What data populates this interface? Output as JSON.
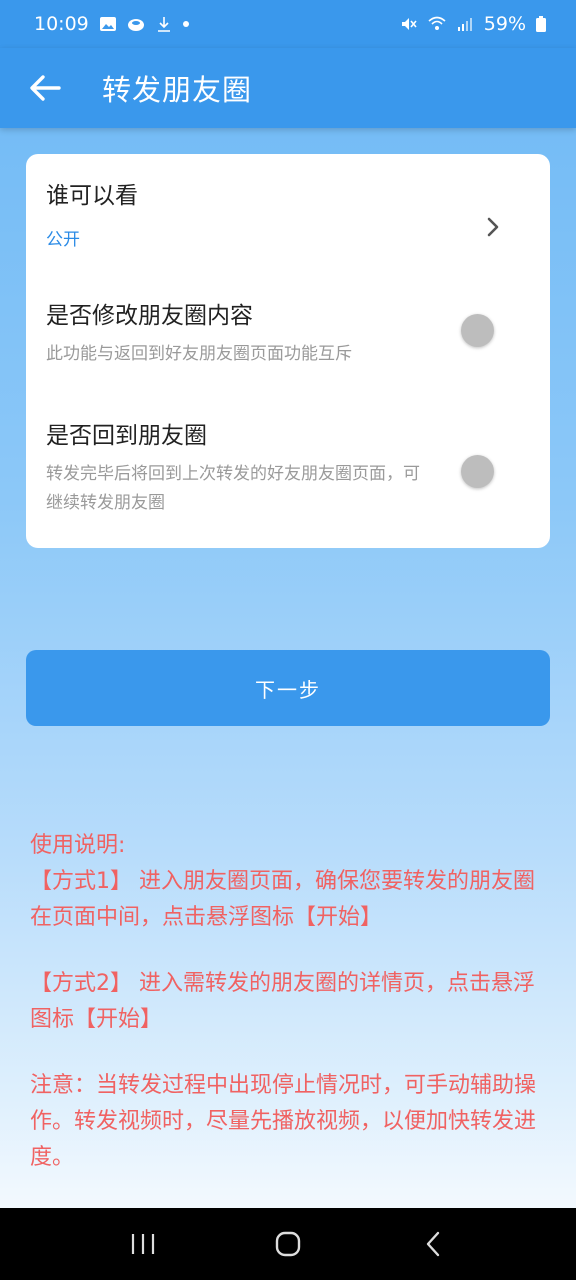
{
  "status_bar": {
    "time": "10:09",
    "battery": "59%"
  },
  "app_bar": {
    "title": "转发朋友圈",
    "back_icon": "arrow-left-icon"
  },
  "settings": {
    "visibility": {
      "title": "谁可以看",
      "value": "公开"
    },
    "modify_content": {
      "title": "是否修改朋友圈内容",
      "description": "此功能与返回到好友朋友圈页面功能互斥",
      "enabled": false
    },
    "return_moments": {
      "title": "是否回到朋友圈",
      "description": "转发完毕后将回到上次转发的好友朋友圈页面，可继续转发朋友圈",
      "enabled": false
    }
  },
  "next_button": {
    "label": "下一步"
  },
  "instructions": {
    "heading": "使用说明:",
    "method1": " 【方式1】 进入朋友圈页面，确保您要转发的朋友圈在页面中间，点击悬浮图标【开始】",
    "method2": " 【方式2】 进入需转发的朋友圈的详情页，点击悬浮图标【开始】",
    "note": " 注意：当转发过程中出现停止情况时，可手动辅助操作。转发视频时，尽量先播放视频，以便加快转发进度。"
  },
  "colors": {
    "primary": "#3a98ec",
    "instruction_text": "#f06262",
    "link_blue": "#2b8be6"
  }
}
